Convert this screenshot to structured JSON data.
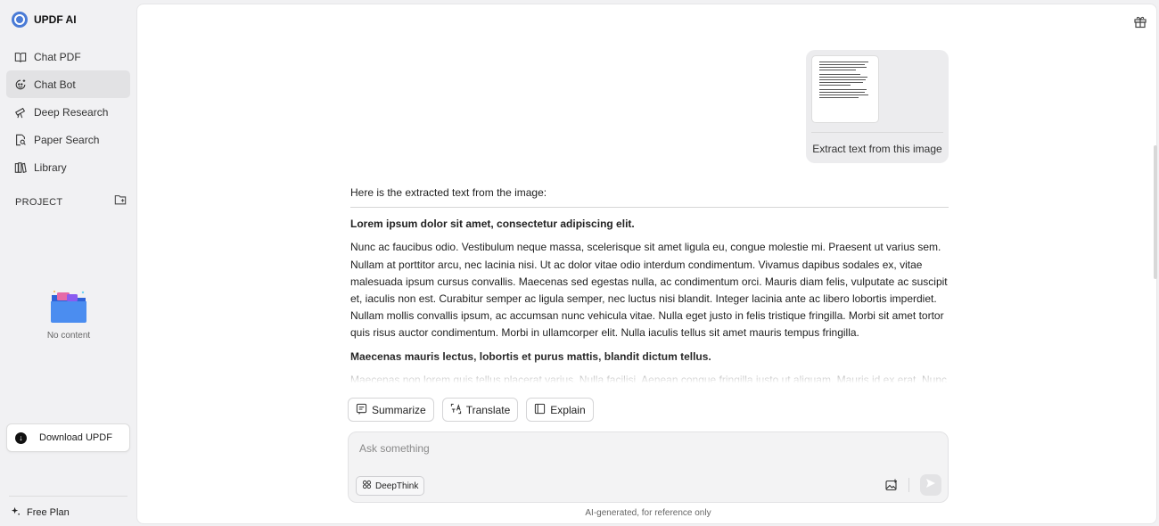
{
  "app": {
    "title": "UPDF AI",
    "logo_icon": "updf-logo-icon"
  },
  "sidebar": {
    "items": [
      {
        "label": "Chat PDF",
        "icon": "book-icon",
        "active": false
      },
      {
        "label": "Chat Bot",
        "icon": "chatbot-icon",
        "active": true
      },
      {
        "label": "Deep Research",
        "icon": "telescope-icon",
        "active": false
      },
      {
        "label": "Paper Search",
        "icon": "paper-search-icon",
        "active": false
      },
      {
        "label": "Library",
        "icon": "library-icon",
        "active": false
      }
    ],
    "project_label": "PROJECT",
    "empty_text": "No content",
    "download_label": "Download UPDF",
    "plan_label": "Free Plan"
  },
  "chat": {
    "user_message": "Extract text from this image",
    "answer_intro": "Here is the extracted text from the image:",
    "heading1": "Lorem ipsum dolor sit amet, consectetur adipiscing elit.",
    "paragraph1": "Nunc ac faucibus odio. Vestibulum neque massa, scelerisque sit amet ligula eu, congue molestie mi. Praesent ut varius sem. Nullam at porttitor arcu, nec lacinia nisi. Ut ac dolor vitae odio interdum condimentum. Vivamus dapibus sodales ex, vitae malesuada ipsum cursus convallis. Maecenas sed egestas nulla, ac condimentum orci. Mauris diam felis, vulputate ac suscipit et, iaculis non est. Curabitur semper ac ligula semper, nec luctus nisi blandit. Integer lacinia ante ac libero lobortis imperdiet. Nullam mollis convallis ipsum, ac accumsan nunc vehicula vitae. Nulla eget justo in felis tristique fringilla. Morbi sit amet tortor quis risus auctor condimentum. Morbi in ullamcorper elit. Nulla iaculis tellus sit amet mauris tempus fringilla.",
    "heading2": "Maecenas mauris lectus, lobortis et purus mattis, blandit dictum tellus.",
    "paragraph2": "Maecenas non lorem quis tellus placerat varius. Nulla facilisi. Aenean congue fringilla justo ut aliquam. Mauris id ex erat. Nunc"
  },
  "actions": {
    "summarize": "Summarize",
    "translate": "Translate",
    "explain": "Explain"
  },
  "input": {
    "placeholder": "Ask something",
    "deepthink_label": "DeepThink",
    "footnote": "AI-generated, for reference only"
  },
  "colors": {
    "active_bg": "#e2e2e4",
    "accent": "#4a7bd6"
  }
}
